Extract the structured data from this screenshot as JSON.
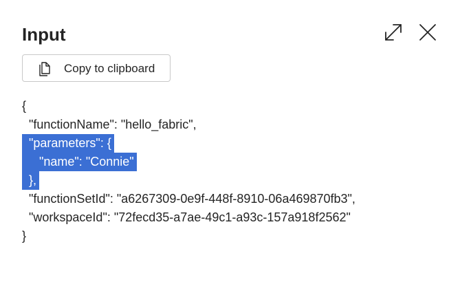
{
  "header": {
    "title": "Input",
    "expand_icon": "expand-diagonal-icon",
    "close_icon": "close-icon"
  },
  "toolbar": {
    "copy_label": "Copy to clipboard",
    "copy_icon": "copy-icon"
  },
  "code": {
    "lines": [
      "{",
      "  \"functionName\": \"hello_fabric\",",
      "  \"parameters\": {",
      "     \"name\": \"Connie\"",
      "  },",
      "  \"functionSetId\": \"a6267309-0e9f-448f-8910-06a469870fb3\",",
      "  \"workspaceId\": \"72fecd35-a7ae-49c1-a93c-157a918f2562\"",
      "}"
    ],
    "selected_lines": [
      2,
      3,
      4
    ]
  },
  "colors": {
    "selection": "#3b6fd4",
    "text": "#242424",
    "border": "#c8c8c8"
  }
}
